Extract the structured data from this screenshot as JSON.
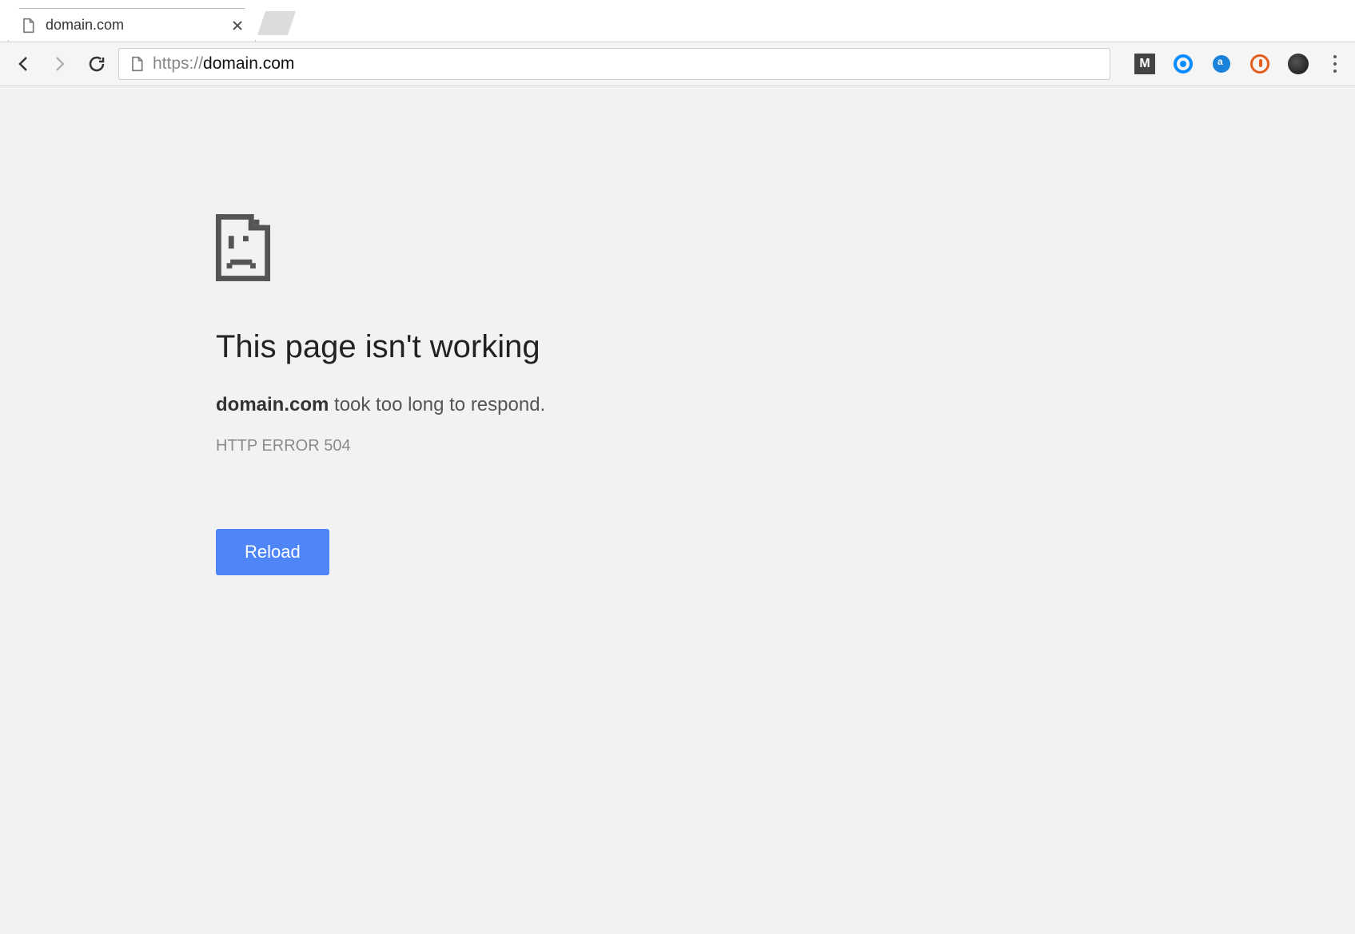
{
  "window": {
    "controls": {
      "minimize": "—",
      "maximize": "☐",
      "close": "✕"
    }
  },
  "tab": {
    "title": "domain.com"
  },
  "toolbar": {
    "url_scheme": "https://",
    "url_host": "domain.com"
  },
  "extensions": [
    {
      "name": "mega-extension",
      "glyph": "M"
    },
    {
      "name": "blue-ring-extension",
      "glyph": ""
    },
    {
      "name": "amazon-assistant-extension",
      "glyph": "a"
    },
    {
      "name": "orange-ring-extension",
      "glyph": ""
    },
    {
      "name": "dark-circle-extension",
      "glyph": ""
    }
  ],
  "error": {
    "heading": "This page isn't working",
    "domain": "domain.com",
    "message_suffix": " took too long to respond.",
    "code": "HTTP ERROR 504",
    "reload_label": "Reload"
  }
}
